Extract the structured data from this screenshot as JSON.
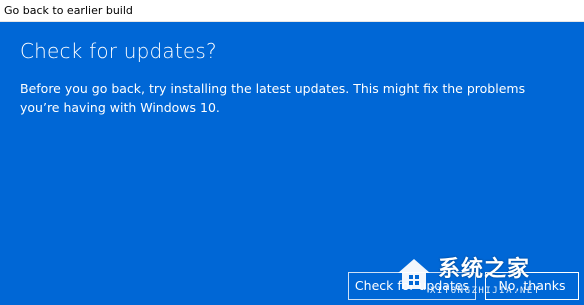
{
  "window": {
    "title": "Go back to earlier build"
  },
  "main": {
    "heading": "Check for updates?",
    "body": "Before you go back, try installing the latest updates. This might fix the problems you’re having with Windows 10."
  },
  "buttons": {
    "check_updates_label": "Check for updates",
    "no_thanks_label": "No, thanks"
  },
  "watermark": {
    "cn_text": "系统之家",
    "en_text": "XITONGZHIJIA.NET"
  },
  "colors": {
    "background": "#0067d6",
    "titlebar": "#ffffff",
    "text": "#ffffff"
  }
}
